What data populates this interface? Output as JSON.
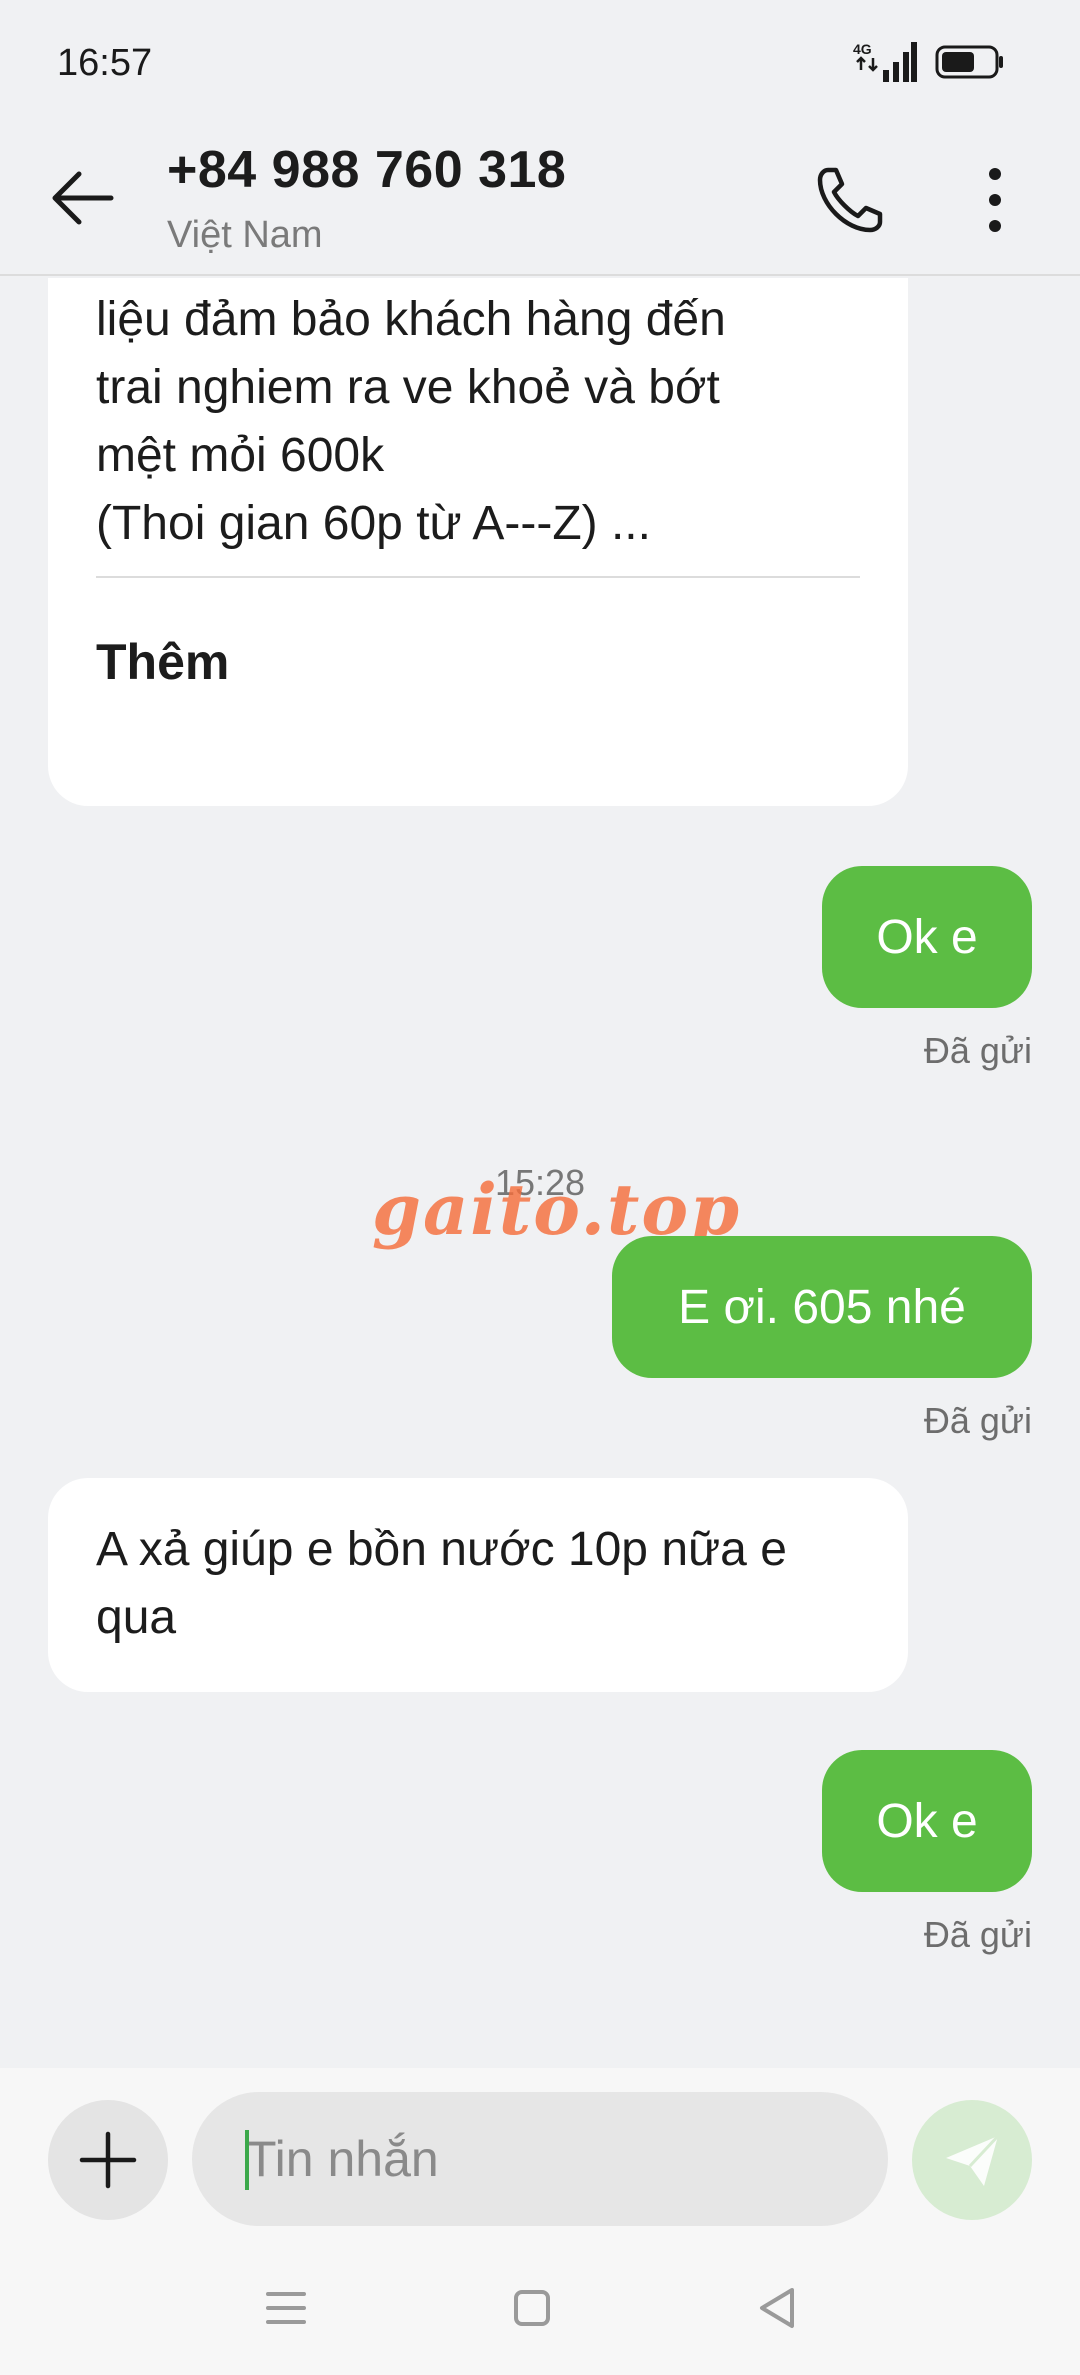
{
  "status_bar": {
    "time": "16:57",
    "network": "4G"
  },
  "header": {
    "contact_number": "+84 988 760 318",
    "contact_region": "Việt Nam"
  },
  "messages": [
    {
      "direction": "in",
      "text": "trị chuyên dung trong ngành trị\nliệu đảm bảo khách hàng đến\ntrai nghiem ra ve khoẻ và bớt\nmệt mỏi 600k\n(Thoi gian 60p từ A---Z) ...",
      "more_label": "Thêm"
    },
    {
      "direction": "out",
      "text": "Ok e",
      "status": "Đã gửi"
    },
    {
      "direction": "out",
      "text": "E ơi. 605 nhé",
      "status": "Đã gửi"
    },
    {
      "direction": "in",
      "text": "A xả giúp e bồn nước 10p nữa e qua"
    },
    {
      "direction": "out",
      "text": "Ok e",
      "status": "Đã gửi"
    }
  ],
  "time_separator": "15:28",
  "watermark": "gaito.top",
  "composer": {
    "placeholder": "Tin nhắn"
  },
  "colors": {
    "accent": "#5cbd44",
    "background": "#f0f1f3",
    "watermark": "#f46e3c"
  }
}
